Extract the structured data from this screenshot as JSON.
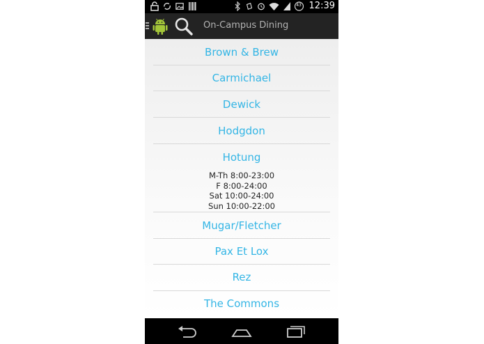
{
  "status_bar": {
    "time": "12:39",
    "left_icons": [
      "lock-icon",
      "sync-icon",
      "image-icon",
      "barcode-icon"
    ],
    "right_icons": [
      "bluetooth-icon",
      "nfc-icon",
      "alarm-icon",
      "wifi-icon",
      "signal-icon",
      "battery-icon"
    ],
    "battery_level": "43"
  },
  "action_bar": {
    "title": "On-Campus Dining",
    "icons": [
      "drawer-indicator-icon",
      "android-icon",
      "search-icon"
    ]
  },
  "dining_halls": [
    {
      "name": "Brown & Brew"
    },
    {
      "name": "Carmichael"
    },
    {
      "name": "Dewick"
    },
    {
      "name": "Hodgdon"
    },
    {
      "name": "Hotung",
      "expanded": true,
      "hours": [
        "M-Th 8:00-23:00",
        "F 8:00-24:00",
        "Sat 10:00-24:00",
        "Sun 10:00-22:00"
      ]
    },
    {
      "name": "Mugar/Fletcher"
    },
    {
      "name": "Pax Et Lox"
    },
    {
      "name": "Rez"
    },
    {
      "name": "The Commons"
    }
  ],
  "colors": {
    "accent": "#33b5e5",
    "action_bar": "#232323",
    "title_text": "#b3b3b3",
    "status_bar": "#000000"
  },
  "nav_bar": {
    "buttons": [
      "back-icon",
      "home-icon",
      "recent-apps-icon"
    ]
  }
}
